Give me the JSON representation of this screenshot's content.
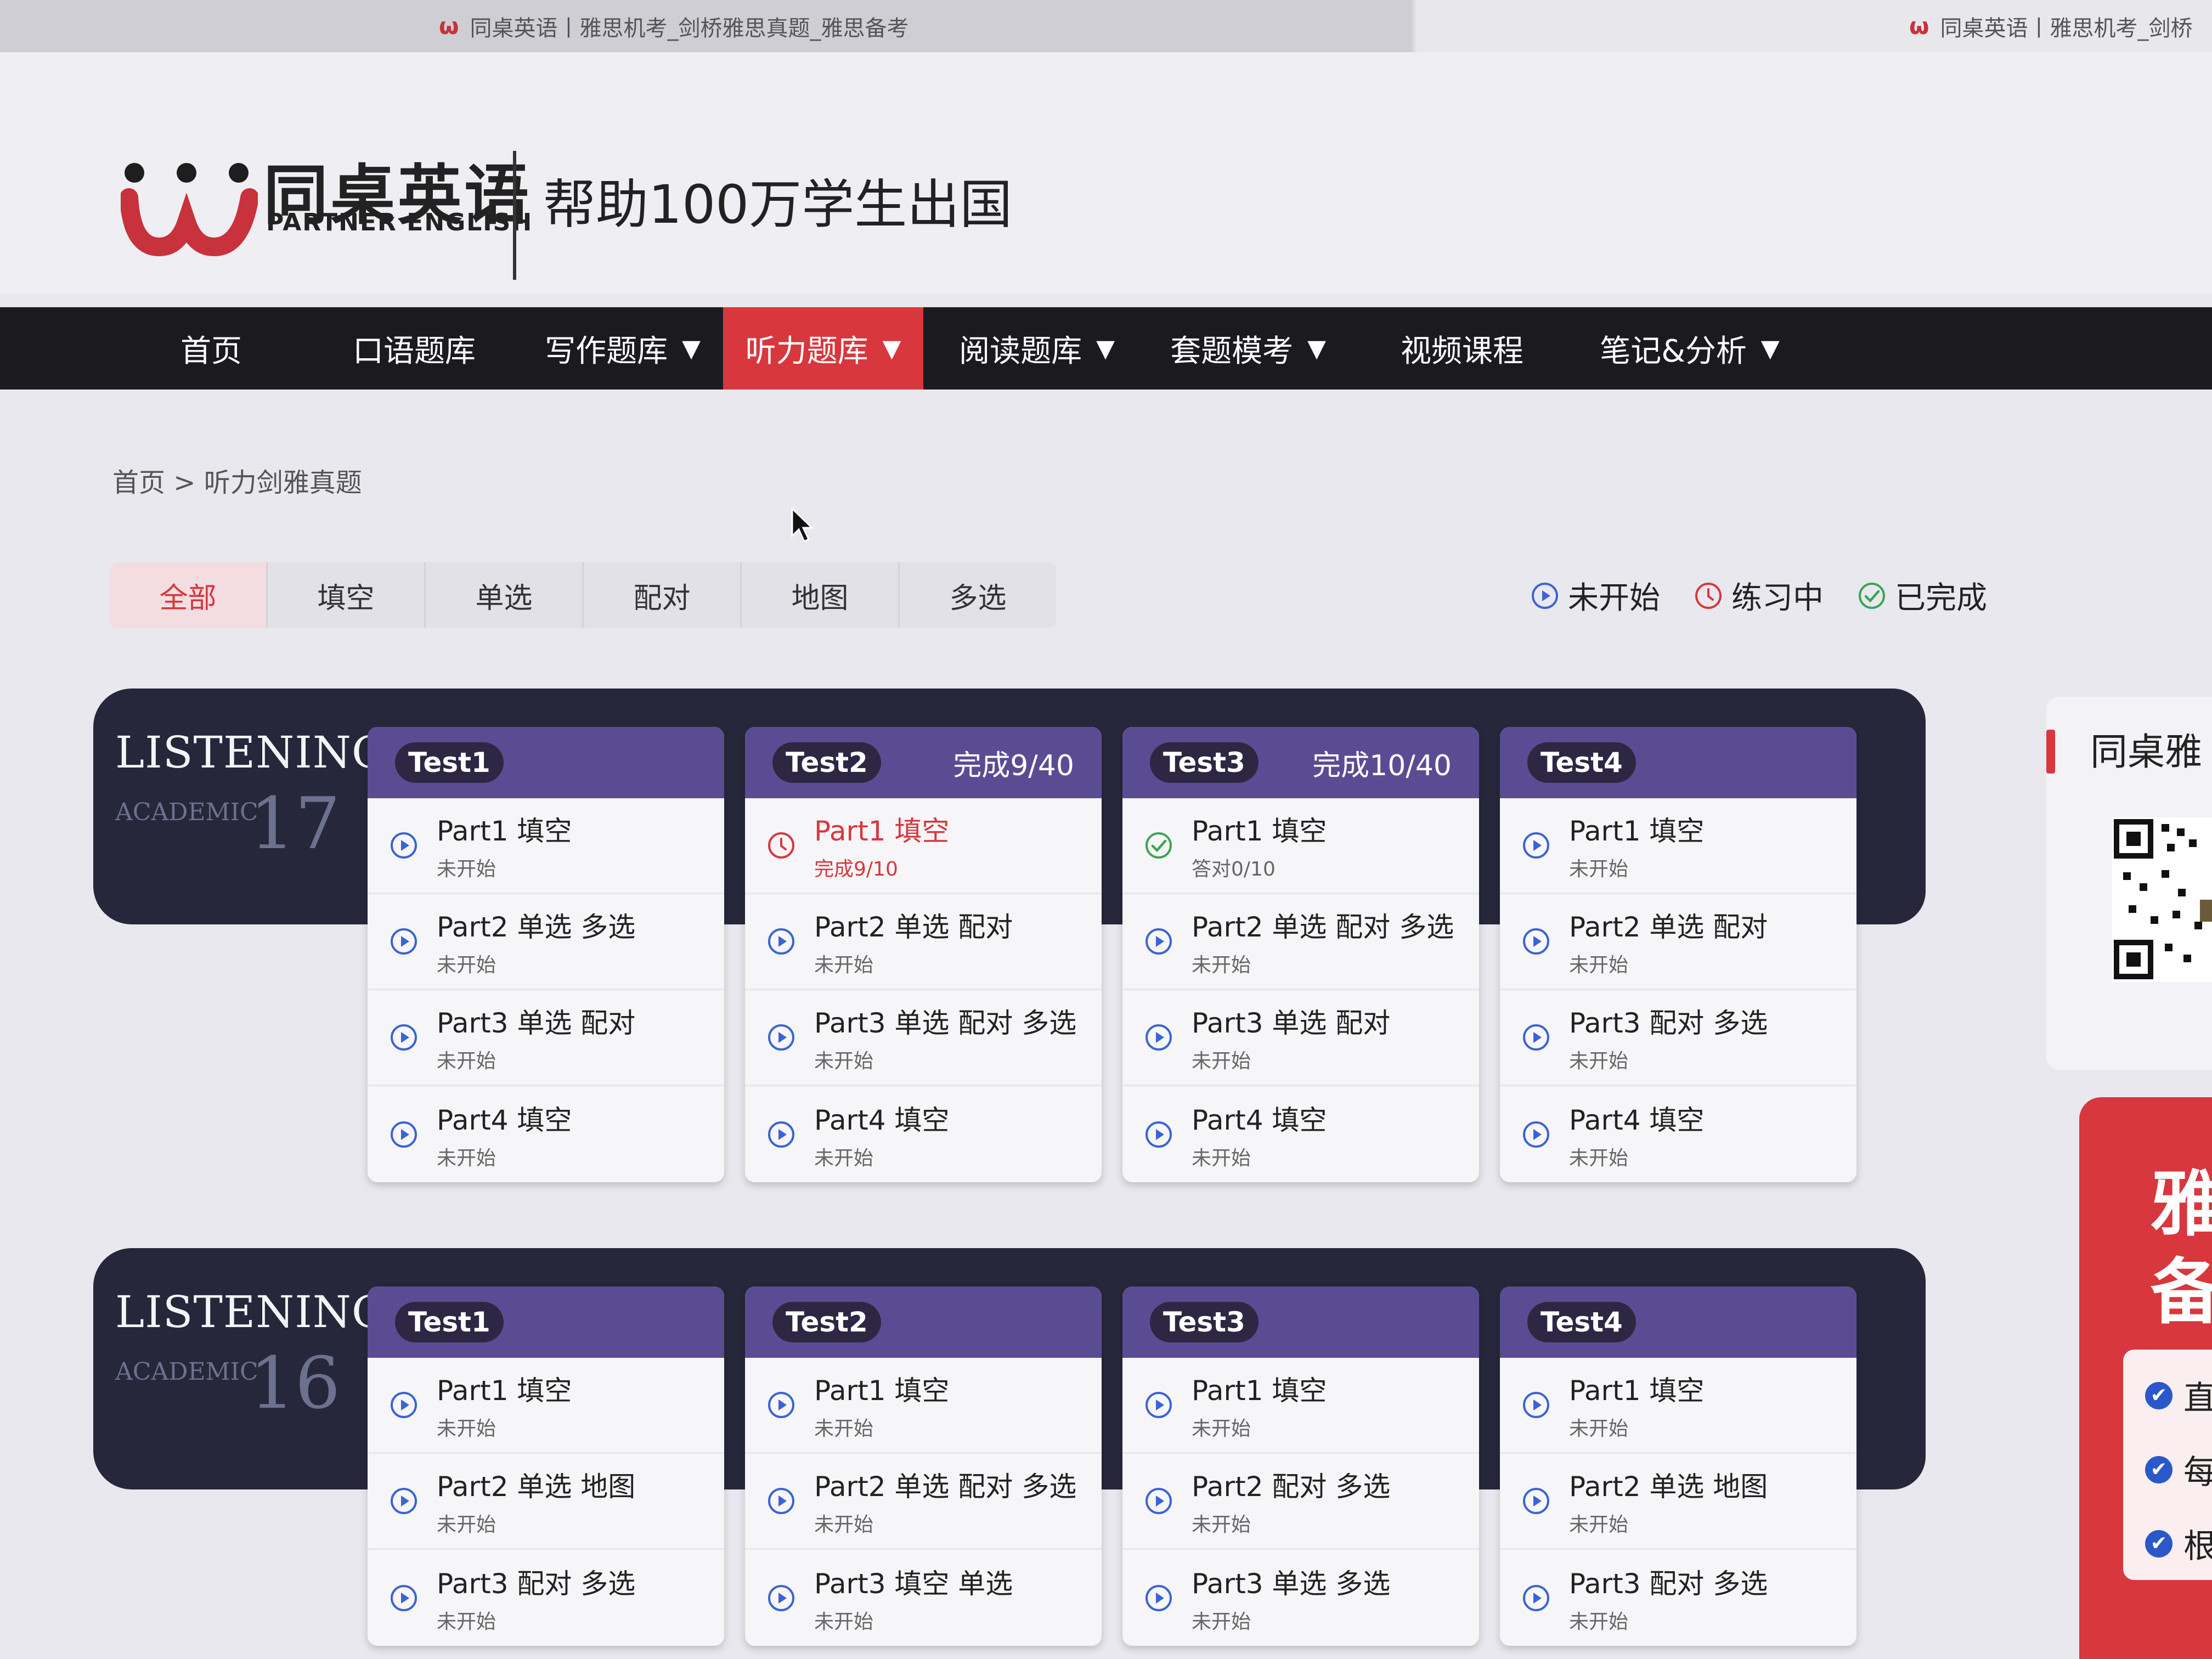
{
  "browser": {
    "tab_title": "同桌英语丨雅思机考_剑桥雅思真题_雅思备考",
    "tab_title_right": "同桌英语丨雅思机考_剑桥",
    "favicon": "partner-english-logo-icon"
  },
  "header": {
    "brand_cn": "同桌英语",
    "brand_en": "PARTNER ENGLISH",
    "slogan": "帮助100万学生出国"
  },
  "nav": {
    "items": [
      {
        "label": "首页",
        "dropdown": false
      },
      {
        "label": "口语题库",
        "dropdown": false
      },
      {
        "label": "写作题库",
        "dropdown": true
      },
      {
        "label": "听力题库",
        "dropdown": true,
        "active": true
      },
      {
        "label": "阅读题库",
        "dropdown": true
      },
      {
        "label": "套题模考",
        "dropdown": true
      },
      {
        "label": "视频课程",
        "dropdown": false
      },
      {
        "label": "笔记&分析",
        "dropdown": true
      }
    ],
    "caret": "▼"
  },
  "breadcrumb": {
    "text": "首页 > 听力剑雅真题"
  },
  "filters": [
    "全部",
    "填空",
    "单选",
    "配对",
    "地图",
    "多选"
  ],
  "legend": {
    "not_started": "未开始",
    "in_progress": "练习中",
    "completed": "已完成"
  },
  "colors": {
    "accent_red": "#d8373d",
    "test_header_purple": "#5a4c93",
    "block_dark": "#26273a",
    "status_blue": "#3b63d6",
    "status_green": "#3aa555"
  },
  "blocks": [
    {
      "listening": "LISTENING",
      "academic": "ACADEMIC",
      "number": "17",
      "tests": [
        {
          "name": "Test1",
          "progress": "",
          "parts": [
            {
              "title": "Part1 填空",
              "status": "未开始",
              "state": "not_started"
            },
            {
              "title": "Part2 单选  多选",
              "status": "未开始",
              "state": "not_started"
            },
            {
              "title": "Part3 单选  配对",
              "status": "未开始",
              "state": "not_started"
            },
            {
              "title": "Part4 填空",
              "status": "未开始",
              "state": "not_started"
            }
          ]
        },
        {
          "name": "Test2",
          "progress": "完成9/40",
          "parts": [
            {
              "title": "Part1 填空",
              "status": "完成9/10",
              "state": "in_progress"
            },
            {
              "title": "Part2 单选  配对",
              "status": "未开始",
              "state": "not_started"
            },
            {
              "title": "Part3 单选  配对  多选",
              "status": "未开始",
              "state": "not_started"
            },
            {
              "title": "Part4 填空",
              "status": "未开始",
              "state": "not_started"
            }
          ]
        },
        {
          "name": "Test3",
          "progress": "完成10/40",
          "parts": [
            {
              "title": "Part1 填空",
              "status": "答对0/10",
              "state": "completed"
            },
            {
              "title": "Part2 单选  配对  多选",
              "status": "未开始",
              "state": "not_started"
            },
            {
              "title": "Part3 单选  配对",
              "status": "未开始",
              "state": "not_started"
            },
            {
              "title": "Part4 填空",
              "status": "未开始",
              "state": "not_started"
            }
          ]
        },
        {
          "name": "Test4",
          "progress": "",
          "parts": [
            {
              "title": "Part1 填空",
              "status": "未开始",
              "state": "not_started"
            },
            {
              "title": "Part2 单选  配对",
              "status": "未开始",
              "state": "not_started"
            },
            {
              "title": "Part3 配对  多选",
              "status": "未开始",
              "state": "not_started"
            },
            {
              "title": "Part4 填空",
              "status": "未开始",
              "state": "not_started"
            }
          ]
        }
      ]
    },
    {
      "listening": "LISTENING",
      "academic": "ACADEMIC",
      "number": "16",
      "tests": [
        {
          "name": "Test1",
          "progress": "",
          "parts": [
            {
              "title": "Part1 填空",
              "status": "未开始",
              "state": "not_started"
            },
            {
              "title": "Part2 单选  地图",
              "status": "未开始",
              "state": "not_started"
            },
            {
              "title": "Part3 配对  多选",
              "status": "未开始",
              "state": "not_started"
            }
          ]
        },
        {
          "name": "Test2",
          "progress": "",
          "parts": [
            {
              "title": "Part1 填空",
              "status": "未开始",
              "state": "not_started"
            },
            {
              "title": "Part2 单选  配对  多选",
              "status": "未开始",
              "state": "not_started"
            },
            {
              "title": "Part3 填空  单选",
              "status": "未开始",
              "state": "not_started"
            }
          ]
        },
        {
          "name": "Test3",
          "progress": "",
          "parts": [
            {
              "title": "Part1 填空",
              "status": "未开始",
              "state": "not_started"
            },
            {
              "title": "Part2 配对  多选",
              "status": "未开始",
              "state": "not_started"
            },
            {
              "title": "Part3 单选  多选",
              "status": "未开始",
              "state": "not_started"
            }
          ]
        },
        {
          "name": "Test4",
          "progress": "",
          "parts": [
            {
              "title": "Part1 填空",
              "status": "未开始",
              "state": "not_started"
            },
            {
              "title": "Part2 单选  地图",
              "status": "未开始",
              "state": "not_started"
            },
            {
              "title": "Part3 配对  多选",
              "status": "未开始",
              "state": "not_started"
            }
          ]
        }
      ]
    }
  ],
  "sidebar": {
    "title": "同桌雅",
    "promo_big": [
      "雅",
      "备"
    ],
    "promo_items": [
      "直",
      "每",
      "根"
    ]
  }
}
